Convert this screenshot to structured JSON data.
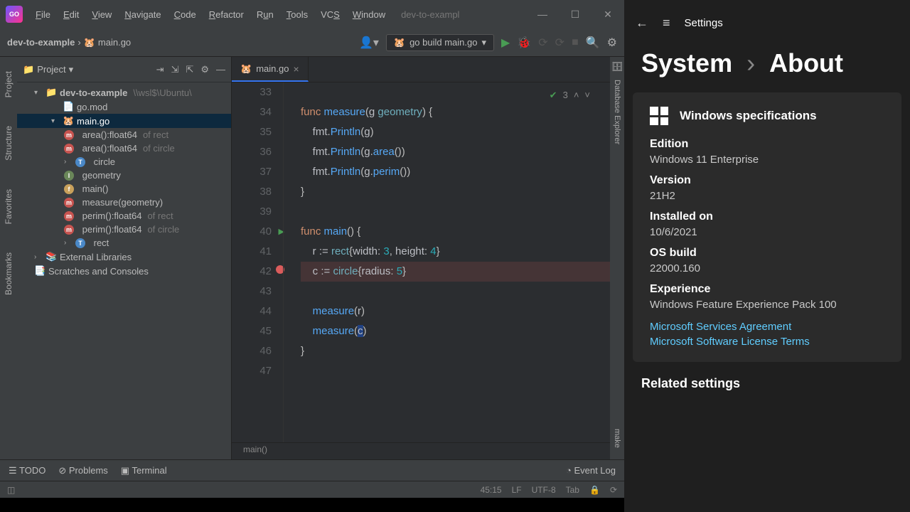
{
  "ide": {
    "menus": [
      "File",
      "Edit",
      "View",
      "Navigate",
      "Code",
      "Refactor",
      "Run",
      "Tools",
      "VCS",
      "Window"
    ],
    "apptitle": "dev-to-exampl",
    "crumb_project": "dev-to-example",
    "crumb_file": "main.go",
    "run_config": "go build main.go",
    "tab_file": "main.go",
    "left_rail": [
      "Project",
      "Structure",
      "Favorites",
      "Bookmarks"
    ],
    "right_rail_db": "Database Explorer",
    "right_rail_make": "make",
    "project_label": "Project",
    "tree": {
      "root": "dev-to-example",
      "root_hint": "\\\\wsl$\\Ubuntu\\",
      "gomod": "go.mod",
      "maingo": "main.go",
      "items": [
        {
          "kind": "m",
          "label": "area():float64",
          "hint": "of rect"
        },
        {
          "kind": "m",
          "label": "area():float64",
          "hint": "of circle"
        },
        {
          "kind": "t",
          "label": "circle"
        },
        {
          "kind": "i",
          "label": "geometry"
        },
        {
          "kind": "f",
          "label": "main()"
        },
        {
          "kind": "m",
          "label": "measure(geometry)"
        },
        {
          "kind": "m",
          "label": "perim():float64",
          "hint": "of rect"
        },
        {
          "kind": "m",
          "label": "perim():float64",
          "hint": "of circle"
        },
        {
          "kind": "t",
          "label": "rect"
        }
      ],
      "ext": "External Libraries",
      "scr": "Scratches and Consoles"
    },
    "inspection_count": "3",
    "code_lines": [
      33,
      34,
      35,
      36,
      37,
      38,
      39,
      40,
      41,
      42,
      43,
      44,
      45,
      46,
      47
    ],
    "breadcrumb2": "main()",
    "bottom": {
      "todo": "TODO",
      "problems": "Problems",
      "terminal": "Terminal",
      "eventlog": "Event Log"
    },
    "status": {
      "pos": "45:15",
      "sep": "LF",
      "enc": "UTF-8",
      "indent": "Tab"
    }
  },
  "settings": {
    "title": "Settings",
    "h1a": "System",
    "h1b": "About",
    "card_head": "Windows specifications",
    "edition_k": "Edition",
    "edition_v": "Windows 11 Enterprise",
    "version_k": "Version",
    "version_v": "21H2",
    "installed_k": "Installed on",
    "installed_v": "10/6/2021",
    "build_k": "OS build",
    "build_v": "22000.160",
    "exp_k": "Experience",
    "exp_v": "Windows Feature Experience Pack 100",
    "link1": "Microsoft Services Agreement",
    "link2": "Microsoft Software License Terms",
    "related": "Related settings"
  }
}
